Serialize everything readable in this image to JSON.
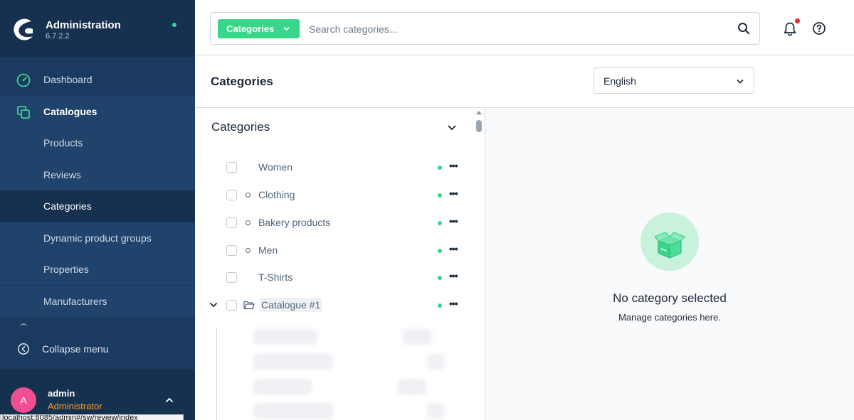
{
  "app": {
    "title": "Administration",
    "version": "6.7.2.2",
    "status_color": "#37d68a"
  },
  "sidebar": {
    "items": [
      {
        "label": "Dashboard",
        "icon": "gauge-icon"
      },
      {
        "label": "Catalogues",
        "icon": "catalogues-icon"
      },
      {
        "label": "Products"
      },
      {
        "label": "Reviews"
      },
      {
        "label": "Categories",
        "active": true
      },
      {
        "label": "Dynamic product groups"
      },
      {
        "label": "Properties"
      },
      {
        "label": "Manufacturers"
      }
    ],
    "collapse_label": "Collapse menu"
  },
  "user": {
    "initial": "A",
    "name": "admin",
    "role": "Administrator"
  },
  "status_bar_url": "localhost:8085/admin#/sw/review/index",
  "search": {
    "type_label": "Categories",
    "placeholder": "Search categories..."
  },
  "page": {
    "title": "Categories",
    "language": "English"
  },
  "tree": {
    "title": "Categories",
    "rows": [
      {
        "label": "Women",
        "bullet": false
      },
      {
        "label": "Clothing",
        "bullet": true
      },
      {
        "label": "Bakery products",
        "bullet": true
      },
      {
        "label": "Men",
        "bullet": true
      },
      {
        "label": "T-Shirts",
        "bullet": false
      }
    ],
    "root": {
      "label": "Catalogue #1"
    },
    "more_glyph": "•••"
  },
  "empty_state": {
    "title": "No category selected",
    "subtitle": "Manage categories here."
  },
  "colors": {
    "accent": "#37d68a",
    "sidebar": "#1b3a60",
    "notification": "#e5283e",
    "avatar": "#ef4e91",
    "role": "#f59e27"
  }
}
